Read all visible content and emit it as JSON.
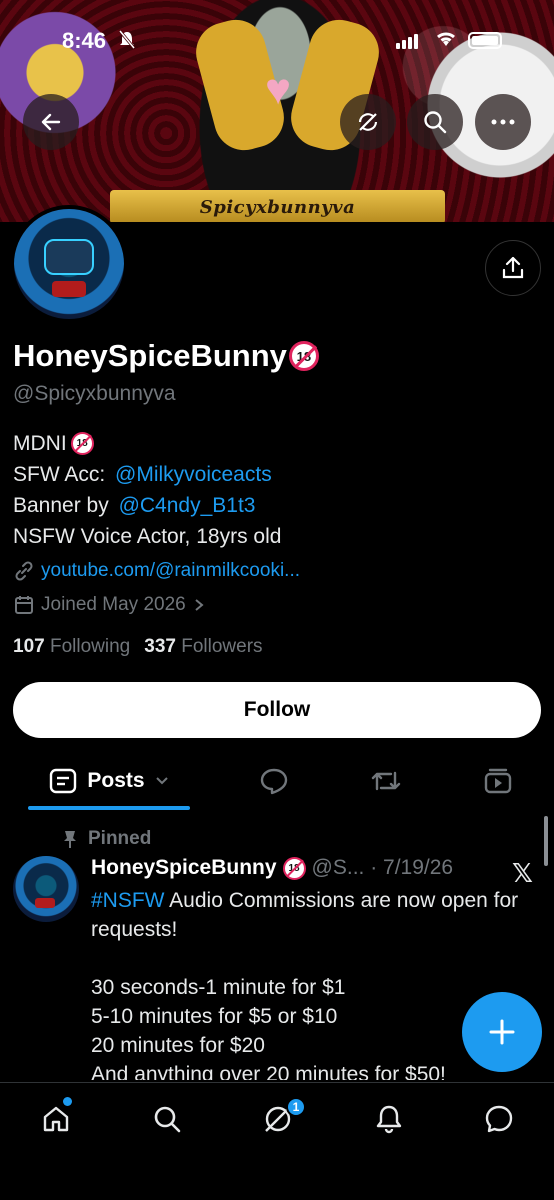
{
  "status_bar": {
    "time": "8:46"
  },
  "banner": {
    "ribbon_text": "Spicyxbunnyva"
  },
  "profile": {
    "display_name": "HoneySpiceBunny",
    "handle": "@Spicyxbunnyva",
    "bio": {
      "line1": "MDNI",
      "line2_prefix": "SFW Acc: ",
      "line2_link": "@Milkyvoiceacts",
      "line3_prefix": "Banner by ",
      "line3_link": "@C4ndy_B1t3",
      "line4": "NSFW Voice Actor, 18yrs old"
    },
    "website": "youtube.com/@rainmilkcooki...",
    "joined": "Joined May 2026",
    "following_count": "107",
    "following_label": "Following",
    "followers_count": "337",
    "followers_label": "Followers",
    "badge_text": "18"
  },
  "follow_button": {
    "label": "Follow"
  },
  "tabs": {
    "posts_label": "Posts"
  },
  "pinned_post": {
    "pinned_label": "Pinned",
    "author": "HoneySpiceBunny",
    "meta": "@S... · 7/19/26",
    "hashtag": "#NSFW",
    "text_after_hashtag": " Audio Commissions are now open for requests!",
    "text_rest": "\n\n30 seconds-1 minute for $1\n5-10 minutes for $5 or $10\n20 minutes for $20\nAnd anything over 20 minutes for $50!"
  },
  "bottom_nav": {
    "messages_badge": "1"
  },
  "colors": {
    "accent": "#1d9bf0",
    "background": "#000000",
    "muted": "#71767b",
    "nsfw_red": "#e0245e"
  },
  "icons": [
    "back-arrow-icon",
    "no-refresh-icon",
    "search-icon",
    "more-icon",
    "share-icon",
    "link-icon",
    "calendar-icon",
    "chevron-right-icon",
    "posts-icon",
    "chevron-down-icon",
    "replies-icon",
    "retweet-icon",
    "media-icon",
    "pin-icon",
    "x-logo-icon",
    "plus-icon",
    "home-icon",
    "explore-icon",
    "grok-icon",
    "notifications-icon",
    "messages-icon"
  ]
}
